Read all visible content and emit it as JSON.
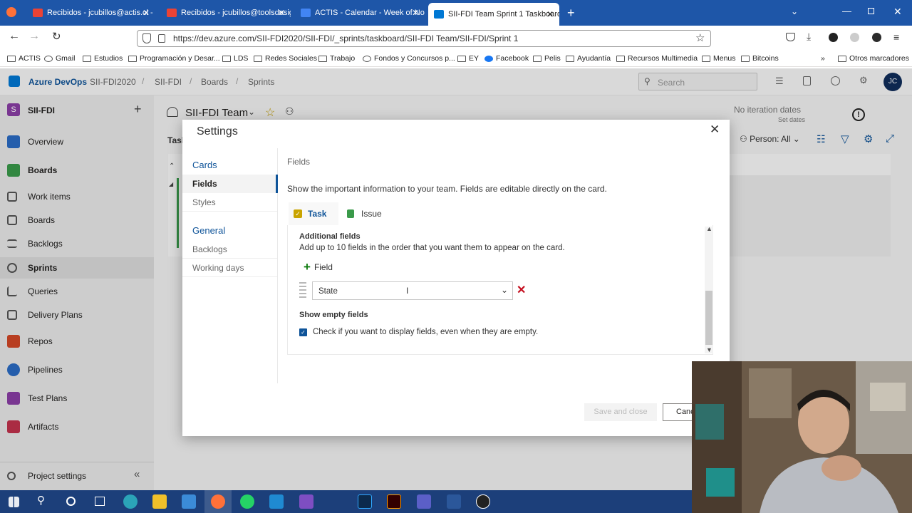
{
  "browser": {
    "tabs": [
      {
        "label": "Recibidos - jcubillos@actis.cl - C",
        "color": "#ea4335"
      },
      {
        "label": "Recibidos - jcubillos@toolsdesig",
        "color": "#ea4335"
      },
      {
        "label": "ACTIS - Calendar - Week of No",
        "color": "#4285f4"
      },
      {
        "label": "SII-FDI Team Sprint 1 Taskboard",
        "color": "#0078d4"
      }
    ],
    "url": "https://dev.azure.com/SII-FDI2020/SII-FDI/_sprints/taskboard/SII-FDI Team/SII-FDI/Sprint 1",
    "bookmarks": [
      "ACTIS",
      "Gmail",
      "Estudios",
      "Programación y Desar...",
      "LDS",
      "Redes Sociales",
      "Trabajo",
      "Fondos y Concursos p...",
      "EY",
      "Facebook",
      "Pelis",
      "Ayudantía",
      "Recursos Multimedia",
      "Menus",
      "Bitcoins"
    ],
    "other_bookmarks": "Otros marcadores"
  },
  "ado": {
    "brand": "Azure DevOps",
    "breadcrumb": [
      "SII-FDI2020",
      "SII-FDI",
      "Boards",
      "Sprints"
    ],
    "search_placeholder": "Search",
    "avatar": "JC",
    "project_letter": "S",
    "project": "SII-FDI",
    "nav": [
      {
        "label": "Overview",
        "color": "#2b6cc4"
      },
      {
        "label": "Boards",
        "color": "#3a9a4a"
      },
      {
        "label": "Work items",
        "color": "#555555"
      },
      {
        "label": "Boards",
        "color": "#555555"
      },
      {
        "label": "Backlogs",
        "color": "#555555"
      },
      {
        "label": "Sprints",
        "color": "#555555"
      },
      {
        "label": "Queries",
        "color": "#555555"
      },
      {
        "label": "Delivery Plans",
        "color": "#555555"
      },
      {
        "label": "Repos",
        "color": "#d24726"
      },
      {
        "label": "Pipelines",
        "color": "#2b6cc4"
      },
      {
        "label": "Test Plans",
        "color": "#8a3ea6"
      },
      {
        "label": "Artifacts",
        "color": "#c2334d"
      }
    ],
    "project_settings": "Project settings",
    "team": "SII-FDI Team",
    "tab_partial": "Task",
    "iteration": "No iteration dates",
    "set_dates": "Set dates",
    "person_filter": "Person: All"
  },
  "dialog": {
    "title": "Settings",
    "nav_groups": [
      {
        "title": "Cards",
        "items": [
          "Fields",
          "Styles"
        ]
      },
      {
        "title": "General",
        "items": [
          "Backlogs",
          "Working days"
        ]
      }
    ],
    "section": "Fields",
    "description": "Show the important information to your team. Fields are editable directly on the card.",
    "tabs": [
      "Task",
      "Issue"
    ],
    "additional_title": "Additional fields",
    "additional_desc": "Add up to 10 fields in the order that you want them to appear on the card.",
    "add_field": "Field",
    "field_value": "State",
    "empty_title": "Show empty fields",
    "empty_desc": "Check if you want to display fields, even when they are empty.",
    "save": "Save and close",
    "cancel": "Canc"
  }
}
